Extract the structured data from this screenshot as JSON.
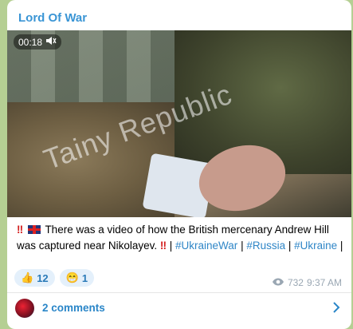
{
  "channel": {
    "title": "Lord Of War"
  },
  "video": {
    "duration": "00:18",
    "watermark": "Tainy Republic"
  },
  "caption": {
    "text": "There was a video of how the British mercenary Andrew Hill was captured near Nikolayev.",
    "sep1": " | ",
    "tag1": "#UkraineWar",
    "sep2": " | ",
    "tag2": "#Russia",
    "sep3": " | ",
    "tag3": "#Ukraine",
    "sep4": " |"
  },
  "reactions": [
    {
      "icon": "👍",
      "count": "12"
    },
    {
      "icon": "😁",
      "count": "1"
    }
  ],
  "meta": {
    "views": "732",
    "time": "9:37 AM"
  },
  "comments": {
    "label": "2 comments"
  }
}
